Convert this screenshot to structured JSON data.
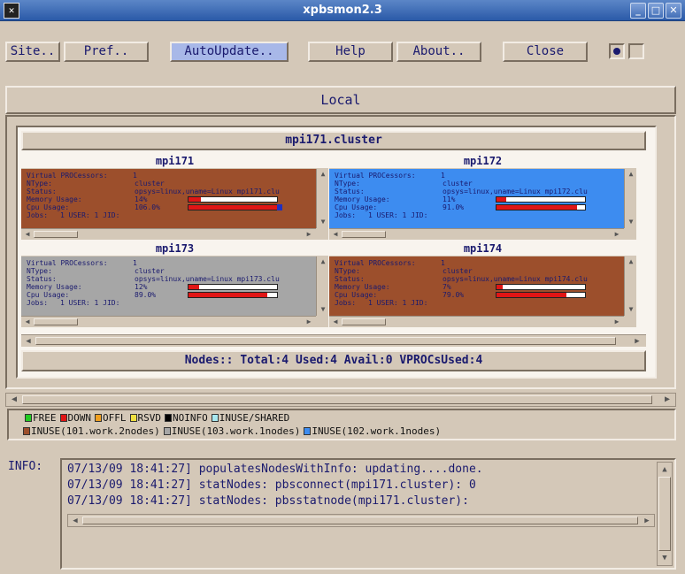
{
  "window": {
    "title": "xpbsmon2.3",
    "icon": "x-terminal-icon"
  },
  "toolbar": {
    "site": "Site..",
    "pref": "Pref..",
    "autoupdate": "AutoUpdate..",
    "help": "Help",
    "about": "About..",
    "close": "Close"
  },
  "local_label": "Local",
  "cluster": {
    "name": "mpi171.cluster",
    "labels": {
      "vprocs": "Virtual PROCessors:",
      "ntype": "NType:",
      "status": "Status:",
      "memory": "Memory Usage:",
      "cpu": "Cpu Usage:",
      "jobs": "Jobs:"
    },
    "nodes": [
      {
        "name": "mpi171",
        "bg": "#9c4f2c",
        "vprocs": "1",
        "ntype": "cluster",
        "status": "opsys=linux,uname=Linux mpi171.clu",
        "memory": "14%",
        "memory_frac": 0.14,
        "cpu": "106.0%",
        "cpu_frac": 1.0,
        "cpu_over": true,
        "jobs": "1 USER:  1 JID:"
      },
      {
        "name": "mpi172",
        "bg": "#3d8cf0",
        "vprocs": "1",
        "ntype": "cluster",
        "status": "opsys=linux,uname=Linux mpi172.clu",
        "memory": "11%",
        "memory_frac": 0.11,
        "cpu": "91.0%",
        "cpu_frac": 0.91,
        "cpu_over": false,
        "jobs": "1 USER:  1 JID:"
      },
      {
        "name": "mpi173",
        "bg": "#a6a6a6",
        "vprocs": "1",
        "ntype": "cluster",
        "status": "opsys=linux,uname=Linux mpi173.clu",
        "memory": "12%",
        "memory_frac": 0.12,
        "cpu": "89.0%",
        "cpu_frac": 0.89,
        "cpu_over": false,
        "jobs": "1 USER:  1 JID:"
      },
      {
        "name": "mpi174",
        "bg": "#9c4f2c",
        "vprocs": "1",
        "ntype": "cluster",
        "status": "opsys=linux,uname=Linux mpi174.clu",
        "memory": "7%",
        "memory_frac": 0.07,
        "cpu": "79.0%",
        "cpu_frac": 0.79,
        "cpu_over": false,
        "jobs": "1 USER:  1 JID:"
      }
    ],
    "summary": "Nodes::  Total:4 Used:4 Avail:0 VPROCsUsed:4"
  },
  "legend": {
    "row1": [
      {
        "label": "FREE",
        "color": "#22cc22"
      },
      {
        "label": "DOWN",
        "color": "#e01515"
      },
      {
        "label": "OFFL",
        "color": "#f0a020"
      },
      {
        "label": "RSVD",
        "color": "#f0e040"
      },
      {
        "label": "NOINFO",
        "color": "#000000"
      },
      {
        "label": "INUSE/SHARED",
        "color": "#a8e8f0"
      }
    ],
    "row2": [
      {
        "label": "INUSE(101.work.2nodes)",
        "color": "#9c4f2c"
      },
      {
        "label": "INUSE(103.work.1nodes)",
        "color": "#a6a6a6"
      },
      {
        "label": "INUSE(102.work.1nodes)",
        "color": "#3d8cf0"
      }
    ]
  },
  "info": {
    "label": "INFO:",
    "lines": [
      "07/13/09 18:41:27] populatesNodesWithInfo: updating....done.",
      "07/13/09 18:41:27] statNodes: pbsconnect(mpi171.cluster): 0",
      "07/13/09 18:41:27] statNodes: pbsstatnode(mpi171.cluster):"
    ]
  }
}
